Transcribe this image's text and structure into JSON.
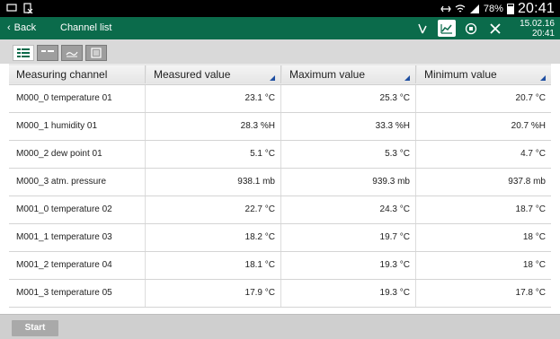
{
  "status_bar": {
    "battery": "78%",
    "time": "20:41"
  },
  "app_bar": {
    "back_label": "Back",
    "title": "Channel list",
    "date": "15.02.16",
    "time": "20:41",
    "accent": "#0b6b4b"
  },
  "table": {
    "headers": [
      "Measuring channel",
      "Measured value",
      "Maximum value",
      "Minimum value"
    ],
    "rows": [
      {
        "channel": "M000_0 temperature 01",
        "measured": "23.1 °C",
        "max": "25.3 °C",
        "min": "20.7 °C"
      },
      {
        "channel": "M000_1 humidity 01",
        "measured": "28.3 %H",
        "max": "33.3 %H",
        "min": "20.7 %H"
      },
      {
        "channel": "M000_2 dew point 01",
        "measured": "5.1 °C",
        "max": "5.3 °C",
        "min": "4.7 °C"
      },
      {
        "channel": "M000_3 atm. pressure",
        "measured": "938.1 mb",
        "max": "939.3 mb",
        "min": "937.8 mb"
      },
      {
        "channel": "M001_0 temperature 02",
        "measured": "22.7 °C",
        "max": "24.3 °C",
        "min": "18.7 °C"
      },
      {
        "channel": "M001_1 temperature 03",
        "measured": "18.2 °C",
        "max": "19.7 °C",
        "min": "18 °C"
      },
      {
        "channel": "M001_2 temperature 04",
        "measured": "18.1 °C",
        "max": "19.3 °C",
        "min": "18 °C"
      },
      {
        "channel": "M001_3 temperature 05",
        "measured": "17.9 °C",
        "max": "19.3 °C",
        "min": "17.8 °C"
      }
    ]
  },
  "bottom_bar": {
    "start_label": "Start"
  },
  "icons": [
    "cast-icon",
    "document-icon",
    "link-icon",
    "wifi-icon",
    "signal-icon",
    "battery-icon",
    "sensor-icon",
    "chart-icon",
    "record-icon",
    "tools-icon",
    "list-view-icon",
    "table-view-icon",
    "graph-view-icon",
    "report-view-icon"
  ]
}
